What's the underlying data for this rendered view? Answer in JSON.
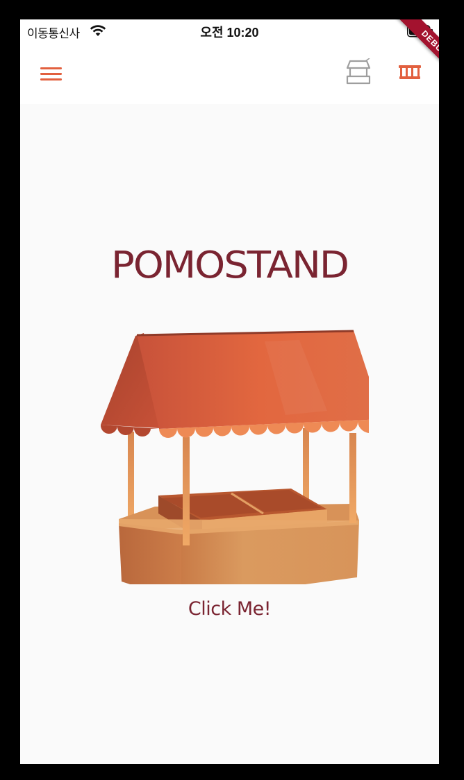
{
  "status_bar": {
    "carrier": "이동통신사",
    "time": "오전 10:20"
  },
  "app_bar": {
    "left_icon": "hamburger-menu-icon",
    "right_icons": [
      "market-stand-outline-icon",
      "market-awning-icon"
    ]
  },
  "debug_banner": {
    "label": "DEBUG"
  },
  "main": {
    "title": "POMOSTAND",
    "illustration": "market-stand-illustration",
    "button_label": "Click Me!"
  },
  "colors": {
    "accent": "#E2603F",
    "title_text": "#7A2431",
    "background": "#FAFAFA",
    "app_bar": "#FFFFFF",
    "debug_ribbon": "#A3122E",
    "icon_gray": "#9E9E9E"
  }
}
